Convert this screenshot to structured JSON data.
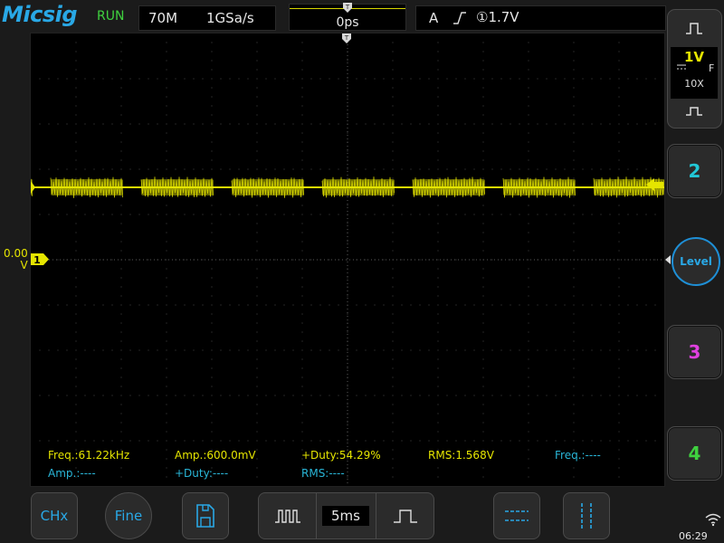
{
  "header": {
    "logo": "Micsig",
    "run_state": "RUN",
    "bandwidth": "70M",
    "sample_rate": "1GSa/s",
    "horizontal_position": "0ps",
    "trigger_mode": "A",
    "trigger_edge_icon": "rising-edge-icon",
    "trigger_level": "①1.7V"
  },
  "screen": {
    "ch1_ground_label": "0.00\nV",
    "ch1_marker_label": "1"
  },
  "measurements": {
    "row1": [
      {
        "text": "Freq.:61.22kHz",
        "color": "#e5e500"
      },
      {
        "text": "Amp.:600.0mV",
        "color": "#e5e500"
      },
      {
        "text": "+Duty:54.29%",
        "color": "#e5e500"
      },
      {
        "text": "RMS:1.568V",
        "color": "#e5e500"
      },
      {
        "text": "Freq.:----",
        "color": "#29b6d8"
      }
    ],
    "row2": [
      {
        "text": "Amp.:----",
        "color": "#29b6d8"
      },
      {
        "text": "+Duty:----",
        "color": "#29b6d8"
      },
      {
        "text": "RMS:----",
        "color": "#29b6d8"
      }
    ]
  },
  "channels": {
    "ch1": {
      "volts_per_div": "1V",
      "coupling_icon": "dc-coupling-icon",
      "bandwidth_flag": "F",
      "probe": "10X",
      "color": "#e5e500"
    },
    "ch2": {
      "label": "2",
      "color": "#22c7d6"
    },
    "ch3": {
      "label": "3",
      "color": "#e040e0"
    },
    "ch4": {
      "label": "4",
      "color": "#3fd13f"
    },
    "level_button": "Level"
  },
  "toolbar": {
    "chx_label": "CHx",
    "fine_label": "Fine",
    "save_icon": "save-file-icon",
    "timebase": "5ms",
    "zoom_out_icon": "dense-pulse-icon",
    "zoom_in_icon": "wide-pulse-icon",
    "horizontal_cursor_icon": "horizontal-cursor-icon",
    "vertical_cursor_icon": "vertical-cursor-icon"
  },
  "status": {
    "time": "06:29"
  },
  "colors": {
    "accent": "#29a8e6",
    "ch1": "#e5e500",
    "run": "#3fd13f"
  }
}
